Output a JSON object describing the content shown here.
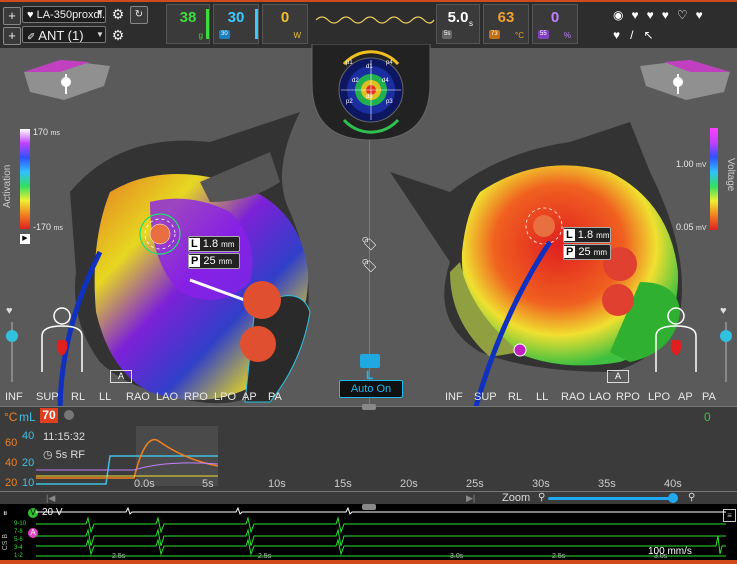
{
  "toolbar": {
    "plus_1": "+",
    "plus_2": "+",
    "heart_glyph": "♥",
    "map_selector": "LA-350proxdi...",
    "catheter_selector": "ANT (1)",
    "chevron": "▼"
  },
  "metrics_left": [
    {
      "value": "38",
      "unit": "g",
      "color": "#3cdc3c"
    },
    {
      "value": "30",
      "chip": "30",
      "unit": "",
      "color": "#3cc8ff"
    },
    {
      "value": "0",
      "unit": "W",
      "color": "#f0c030"
    }
  ],
  "metrics_right": [
    {
      "value": "5.0",
      "chip": "5s",
      "unit": "s",
      "color": "#ffffff"
    },
    {
      "value": "63",
      "chip": "73",
      "unit": "°C",
      "color": "#f0a030"
    },
    {
      "value": "0",
      "chip": "55",
      "unit": "%",
      "color": "#c080ff"
    }
  ],
  "bullseye_labels": {
    "p1": "p1",
    "d1": "d1",
    "p4": "p4",
    "d4": "d4",
    "p2": "p2",
    "d2": "d2",
    "p3": "p3",
    "d3": "d3"
  },
  "activation_scale": {
    "label": "Activation",
    "max": "170",
    "min": "-170",
    "unit": "ms"
  },
  "voltage_scale": {
    "label": "Voltage",
    "max": "1.00",
    "min": "0.05",
    "unit": "mV"
  },
  "left_tag": {
    "l_label": "L",
    "l_value": "1.8",
    "l_unit": "mm",
    "p_label": "P",
    "p_value": "25",
    "p_unit": "mm"
  },
  "right_tag": {
    "l_label": "L",
    "l_value": "1.8",
    "l_unit": "mm",
    "p_label": "P",
    "p_value": "25",
    "p_unit": "mm"
  },
  "view_labels_left": [
    "INF",
    "SUP",
    "RL",
    "LL",
    "RAO",
    "LAO",
    "RPO",
    "LPO",
    "AP",
    "PA"
  ],
  "view_labels_right": [
    "INF",
    "SUP",
    "RL",
    "LL",
    "RAO",
    "LAO",
    "RPO",
    "LPO",
    "AP",
    "PA"
  ],
  "badge_a": "A",
  "auto_on": {
    "label": "Auto On",
    "letter": "L"
  },
  "timeline": {
    "left_units": "°C",
    "ml_label": "mL",
    "ml_value": "70",
    "clock": "11:15:32",
    "rf_label": "5s RF",
    "y_temp": [
      "60",
      "40",
      "20"
    ],
    "y_flow": [
      "40",
      "20",
      "10"
    ],
    "right_axis": "0",
    "ticks": [
      "0.0s",
      "5s",
      "10s",
      "15s",
      "20s",
      "25s",
      "30s",
      "35s",
      "40s"
    ],
    "zoom_label": "Zoom"
  },
  "ecg": {
    "v_label": "20 V",
    "v_badge": "V",
    "a_badge": "A",
    "csb": "CS B",
    "channels": [
      "9-10",
      "7-8",
      "5-6",
      "3-4",
      "1-2"
    ],
    "speed": "100 mm/s",
    "time_marks": [
      "2.5s",
      "2.5s",
      "3.0s",
      "2.5s",
      "3.0s"
    ]
  }
}
